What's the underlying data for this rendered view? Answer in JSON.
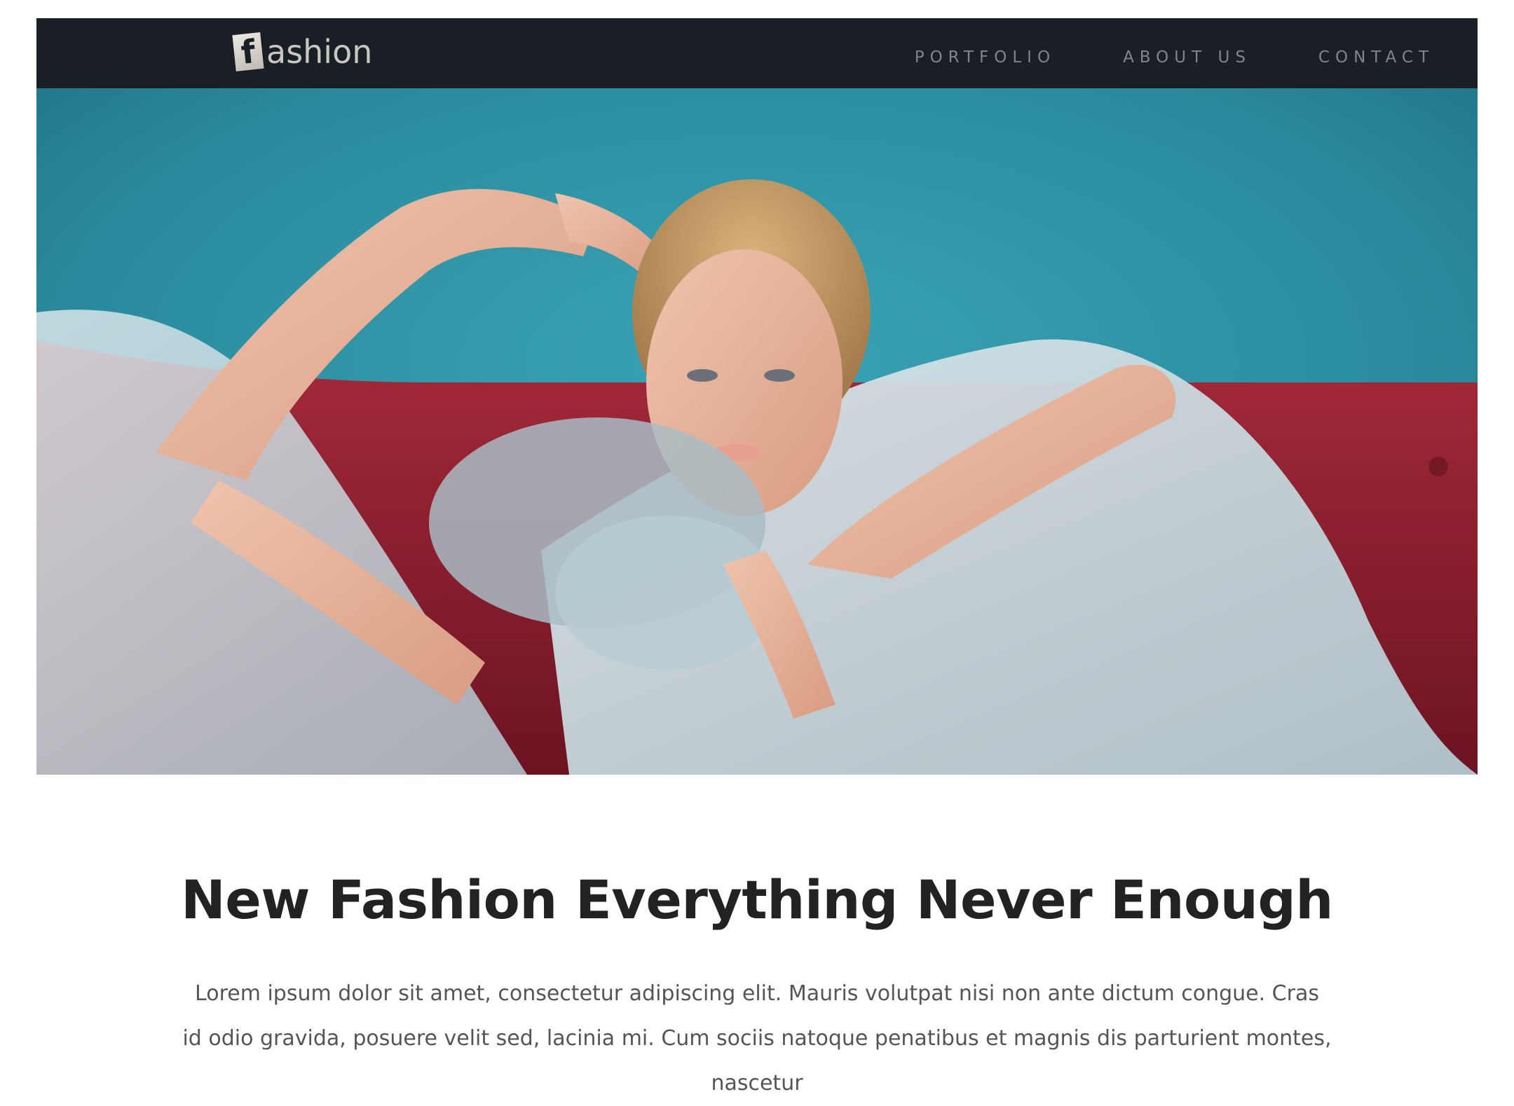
{
  "brand": {
    "logo_letter": "f",
    "logo_text": "ashion"
  },
  "nav": {
    "items": [
      {
        "label": "PORTFOLIO"
      },
      {
        "label": "ABOUT US"
      },
      {
        "label": "CONTACT"
      }
    ]
  },
  "hero": {
    "image_description": "fashion model in tulle gown reclining on red velvet sofa against teal wall"
  },
  "main": {
    "headline": "New Fashion Everything Never Enough",
    "paragraph": "Lorem ipsum dolor sit amet, consectetur adipiscing elit. Mauris volutpat nisi non ante dictum congue. Cras id odio gravida, posuere velit sed, lacinia mi. Cum sociis natoque penatibus et magnis dis parturient montes, nascetur"
  },
  "colors": {
    "navbar_bg": "#1a1f26",
    "nav_text": "#7c8590",
    "heading": "#222222",
    "body_text": "#555555",
    "hero_wall": "#2f8ea0",
    "hero_sofa": "#8e1f2e"
  }
}
